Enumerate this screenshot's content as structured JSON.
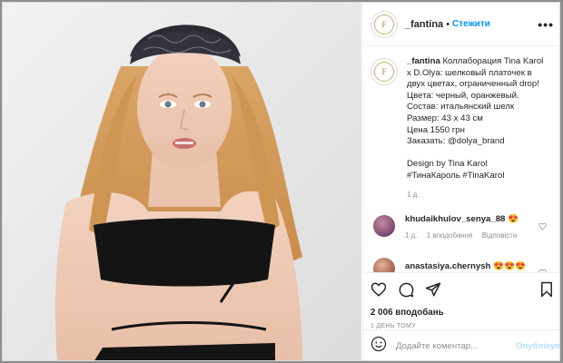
{
  "post": {
    "username": "_fantina",
    "follow_label": "Стежити",
    "more_label": "•••",
    "avatar_text": "F"
  },
  "caption": {
    "username": "_fantina",
    "lines": [
      "Коллаборация Tina Karol",
      "x D.Olya: шелковый платочек в",
      "двух цветах, ограниченный drop!",
      "Цвета: черный, оранжевый.",
      "Состав: итальянский шелк",
      "Размер: 43 х 43 см",
      "Цена 1550 грн",
      "Заказать: @dolya_brand",
      "",
      "Design by Tina Karol",
      "#ТинаКароль #TinaKarol"
    ],
    "time": "1 д."
  },
  "comments": [
    {
      "username": "khudaikhulov_senya_88",
      "text": "😍",
      "time": "1 д.",
      "likes": "1 вподобання",
      "reply": "Відповісти",
      "avatar_color": "#7a3a7a"
    },
    {
      "username": "anastasiya.chernysh",
      "text": "😍😍😍",
      "avatar_color": "#a05a3a"
    }
  ],
  "stats": {
    "likes": "2 006 вподобань",
    "ago": "1 ДЕНЬ ТОМУ"
  },
  "add_comment": {
    "placeholder": "Додайте коментар...",
    "publish_label": "Опублікувати"
  }
}
